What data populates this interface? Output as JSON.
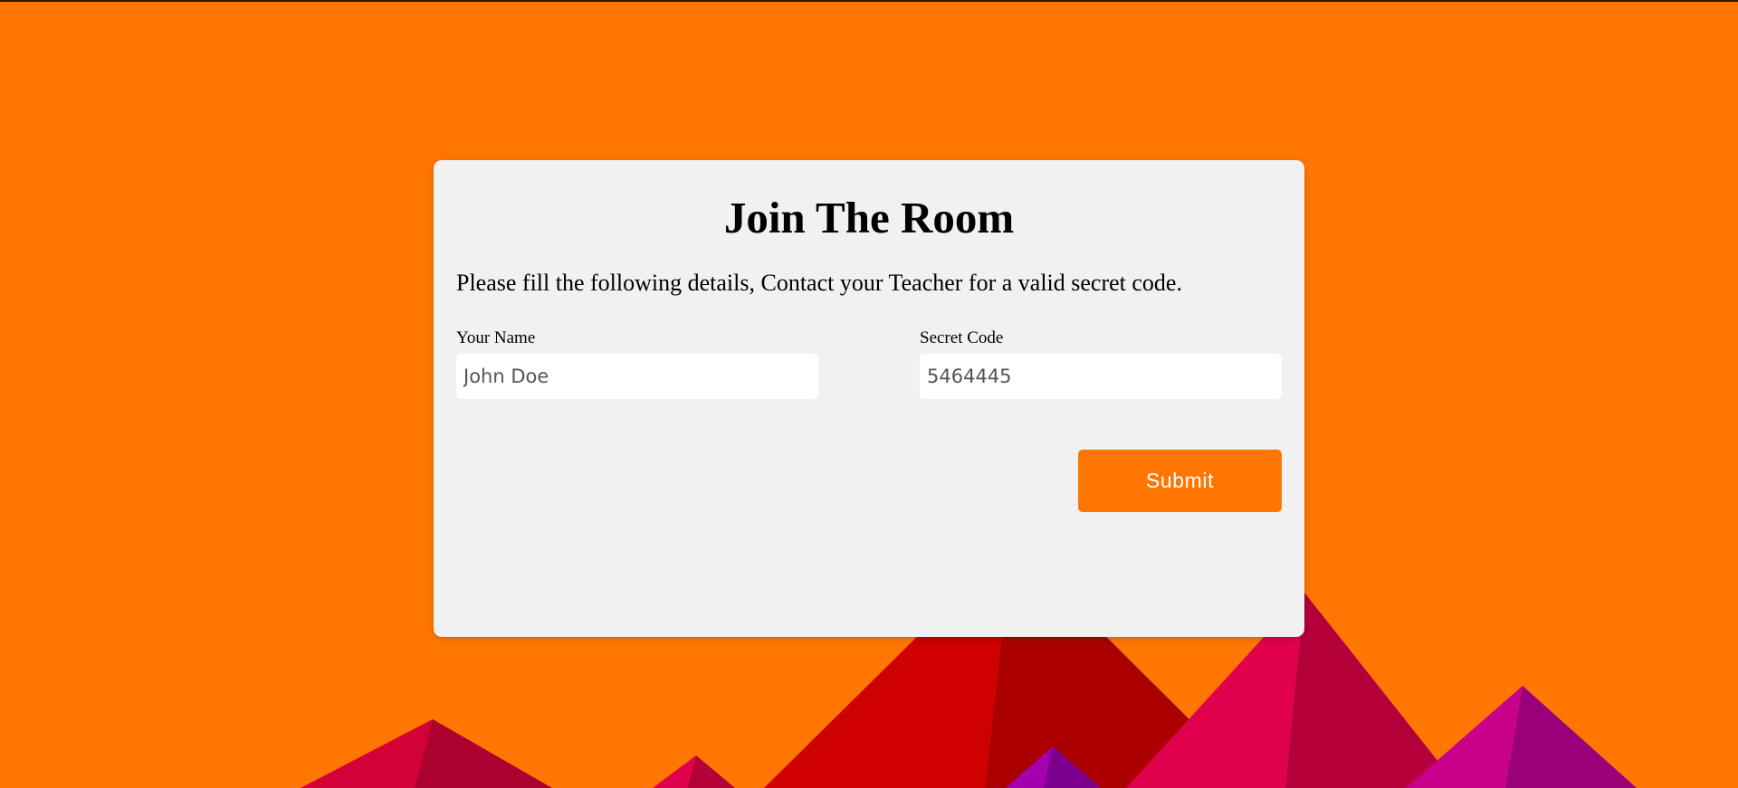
{
  "page": {
    "background_color": "#ff7702"
  },
  "form": {
    "title": "Join The Room",
    "instructions": "Please fill the following details, Contact your Teacher for a valid secret code.",
    "name_field": {
      "label": "Your Name",
      "value": "John Doe"
    },
    "code_field": {
      "label": "Secret Code",
      "value": "5464445"
    },
    "submit_label": "Submit",
    "accent_color": "#ff7702",
    "card_color": "#f1f1f1"
  },
  "decoration": {
    "mountain_colors": [
      "#d40038",
      "#ad0030",
      "#cf0000",
      "#aa0000",
      "#e0004e",
      "#b4003a",
      "#c8008a",
      "#9a007a",
      "#a400b0",
      "#7c0090"
    ]
  }
}
